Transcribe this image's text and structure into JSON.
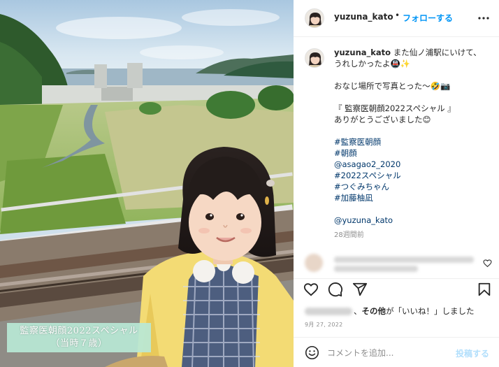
{
  "photo": {
    "caption_line1": "監察医朝顔2022スペシャル",
    "caption_line2": "（当時７歳）"
  },
  "header": {
    "username": "yuzuna_kato",
    "separator": "•",
    "follow_label": "フォローする",
    "more_icon": "more-horizontal-icon"
  },
  "caption": {
    "username": "yuzuna_kato",
    "line1": "また仙ノ浦駅にいけて、",
    "line2": "うれしかったよ🚇✨",
    "line3": "おなじ場所で写真とった〜🤣📷",
    "line4": "『 監察医朝顔2022スペシャル 』",
    "line5": "ありがとうございました😊",
    "tags": [
      "#監察医朝顔",
      "#朝顔",
      "@asagao2_2020",
      "#2022スペシャル",
      "#つぐみちゃん",
      "#加藤柚凪"
    ],
    "mention": "@yuzuna_kato",
    "time_ago": "28週間前"
  },
  "actions": {
    "icons": [
      "heart-icon",
      "comment-icon",
      "share-icon",
      "bookmark-icon"
    ]
  },
  "likes": {
    "prefix": "、",
    "others": "その他",
    "suffix": "が「いいね！」しました"
  },
  "date": "9月 27, 2022",
  "comment_box": {
    "placeholder": "コメントを追加...",
    "post_label": "投稿する"
  },
  "colors": {
    "link_blue": "#0095f6",
    "hashtag": "#00376b",
    "muted": "#8e8e8e",
    "post_disabled": "#b2dffc",
    "caption_bg": "#b8e8d6"
  }
}
